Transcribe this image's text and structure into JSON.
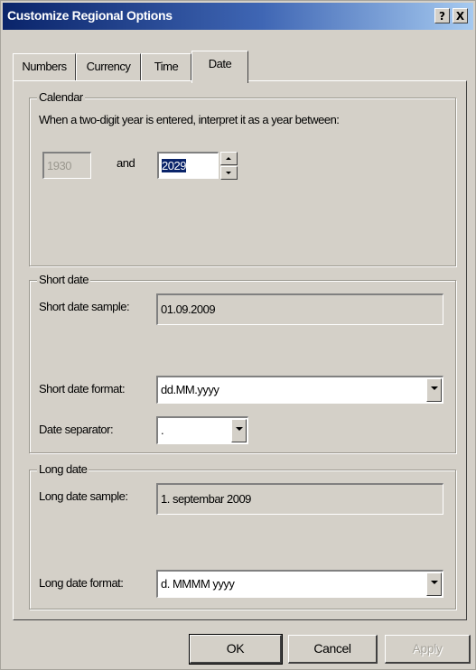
{
  "window": {
    "title": "Customize Regional Options",
    "help_button": "?",
    "close_button": "X"
  },
  "tabs": [
    {
      "label": "Numbers"
    },
    {
      "label": "Currency"
    },
    {
      "label": "Time"
    },
    {
      "label": "Date",
      "selected": true
    }
  ],
  "calendar": {
    "group_label": "Calendar",
    "description": "When a two-digit year is entered, interpret it as a year between:",
    "start_year": "1930",
    "and_label": "and",
    "end_year": "2029"
  },
  "short_date": {
    "group_label": "Short date",
    "sample_label": "Short date sample:",
    "sample_value": "01.09.2009",
    "format_label": "Short date format:",
    "format_value": "dd.MM.yyyy",
    "separator_label": "Date separator:",
    "separator_value": "."
  },
  "long_date": {
    "group_label": "Long date",
    "sample_label": "Long date sample:",
    "sample_value": "1. septembar 2009",
    "format_label": "Long date format:",
    "format_value": "d. MMMM yyyy"
  },
  "buttons": {
    "ok": "OK",
    "cancel": "Cancel",
    "apply": "Apply"
  },
  "colors": {
    "title_bar_start": "#0a246a",
    "title_bar_end": "#a6caf0",
    "face": "#d4d0c8",
    "selection": "#0a246a"
  }
}
